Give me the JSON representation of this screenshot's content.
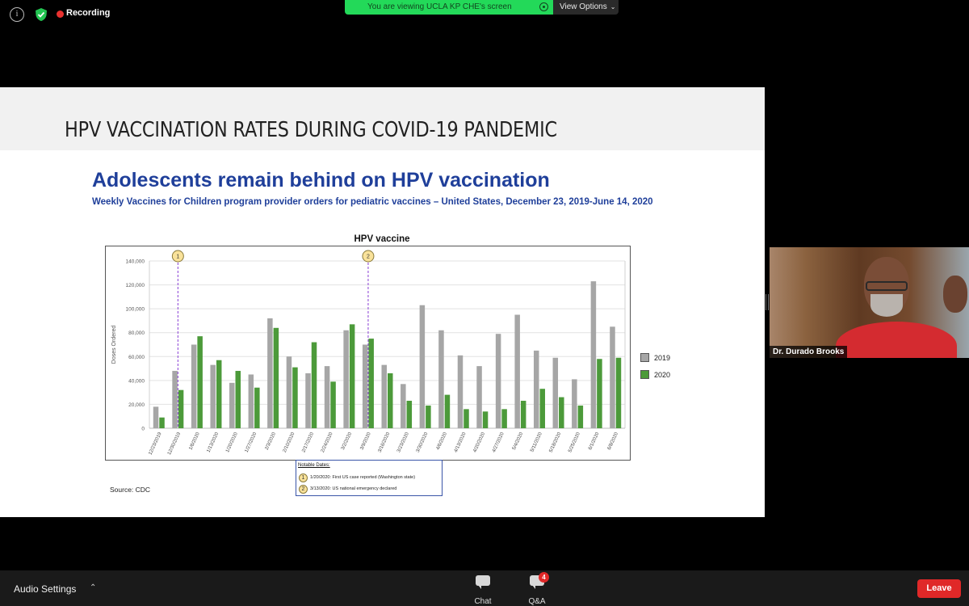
{
  "meeting": {
    "recording_label": "Recording",
    "viewing_banner": "You are viewing UCLA KP CHE's screen",
    "view_options_label": "View Options",
    "colors": {
      "recording": "#e8312f",
      "banner": "#23d959",
      "leave": "#e02828"
    }
  },
  "slide": {
    "title": "HPV VACCINATION RATES DURING COVID-19 PANDEMIC",
    "headline": "Adolescents remain behind on HPV vaccination",
    "subheadline": "Weekly Vaccines for Children program provider orders for pediatric vaccines – United States, December 23, 2019-June 14, 2020",
    "source": "Source: CDC",
    "notable_dates": {
      "title": "Notable Dates:",
      "items": [
        {
          "marker": "1",
          "text": "1/20/2020: First US case reported (Washington state)"
        },
        {
          "marker": "2",
          "text": "3/13/2020: US national emergency declared"
        }
      ]
    }
  },
  "chart_data": {
    "type": "bar",
    "title": "HPV vaccine",
    "ylabel": "Doses Ordered",
    "xlabel": "",
    "ylim": [
      0,
      140000
    ],
    "yticks": [
      "0",
      "20,000",
      "40,000",
      "60,000",
      "80,000",
      "100,000",
      "120,000",
      "140,000"
    ],
    "categories": [
      "12/23/2019",
      "12/30/2019",
      "1/6/2020",
      "1/13/2020",
      "1/20/2020",
      "1/27/2020",
      "2/3/2020",
      "2/10/2020",
      "2/17/2020",
      "2/24/2020",
      "3/2/2020",
      "3/9/2020",
      "3/16/2020",
      "3/23/2020",
      "3/30/2020",
      "4/6/2020",
      "4/13/2020",
      "4/20/2020",
      "4/27/2020",
      "5/4/2020",
      "5/11/2020",
      "5/18/2020",
      "5/25/2020",
      "6/1/2020",
      "6/8/2020"
    ],
    "series": [
      {
        "name": "2019",
        "color": "#a6a6a6",
        "values": [
          18000,
          48000,
          70000,
          53000,
          38000,
          45000,
          92000,
          60000,
          46000,
          52000,
          82000,
          70000,
          53000,
          37000,
          103000,
          82000,
          61000,
          52000,
          79000,
          95000,
          65000,
          59000,
          41000,
          123000,
          85000
        ]
      },
      {
        "name": "2020",
        "color": "#4c9a3a",
        "values": [
          9000,
          32000,
          77000,
          57000,
          48000,
          34000,
          84000,
          51000,
          72000,
          39000,
          87000,
          75000,
          46000,
          23000,
          19000,
          28000,
          16000,
          14000,
          16000,
          23000,
          33000,
          26000,
          19000,
          58000,
          59000
        ]
      }
    ],
    "annotations": [
      {
        "marker": "1",
        "at_category": "12/30/2019"
      },
      {
        "marker": "2",
        "at_category": "3/9/2020"
      }
    ],
    "legend_position": "right"
  },
  "video": {
    "participant_name": "Dr. Durado Brooks"
  },
  "toolbar": {
    "audio_settings_label": "Audio Settings",
    "chat_label": "Chat",
    "qa_label": "Q&A",
    "qa_badge": "4",
    "leave_label": "Leave"
  },
  "icons": [
    "info-icon",
    "shield-check-icon",
    "recording-dot-icon",
    "view-options-chevron-icon",
    "chat-icon",
    "qa-icon",
    "caret-up-icon"
  ]
}
